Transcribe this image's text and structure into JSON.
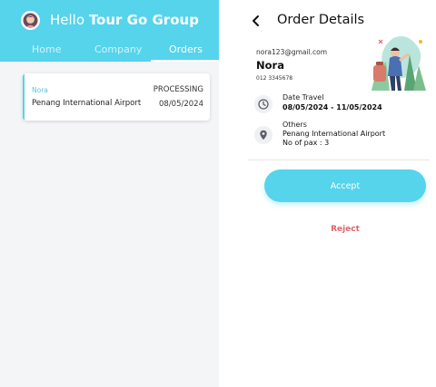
{
  "left": {
    "greeting": "Hello",
    "company_name": "Tour Go Group",
    "tabs": [
      {
        "label": "Home"
      },
      {
        "label": "Company"
      },
      {
        "label": "Orders"
      }
    ],
    "active_tab": "Orders",
    "order": {
      "name": "Nora",
      "status": "PROCESSING",
      "location": "Penang International Airport",
      "date": "08/05/2024"
    }
  },
  "right": {
    "title": "Order Details",
    "customer": {
      "email": "nora123@gmail.com",
      "name": "Nora",
      "phone": "012 3345678"
    },
    "travel": {
      "label": "Date Travel",
      "value": "08/05/2024 - 11/05/2024"
    },
    "others": {
      "label": "Others",
      "location": "Penang International Airport",
      "pax": "No of pax : 3"
    },
    "accept_label": "Accept",
    "reject_label": "Reject"
  },
  "colors": {
    "primary": "#55d4ec",
    "reject": "#e0646c",
    "background_left": "#f4f5f7"
  },
  "icons": [
    "avatar-icon",
    "back-arrow-icon",
    "clock-icon",
    "location-pin-icon",
    "travel-illustration"
  ]
}
